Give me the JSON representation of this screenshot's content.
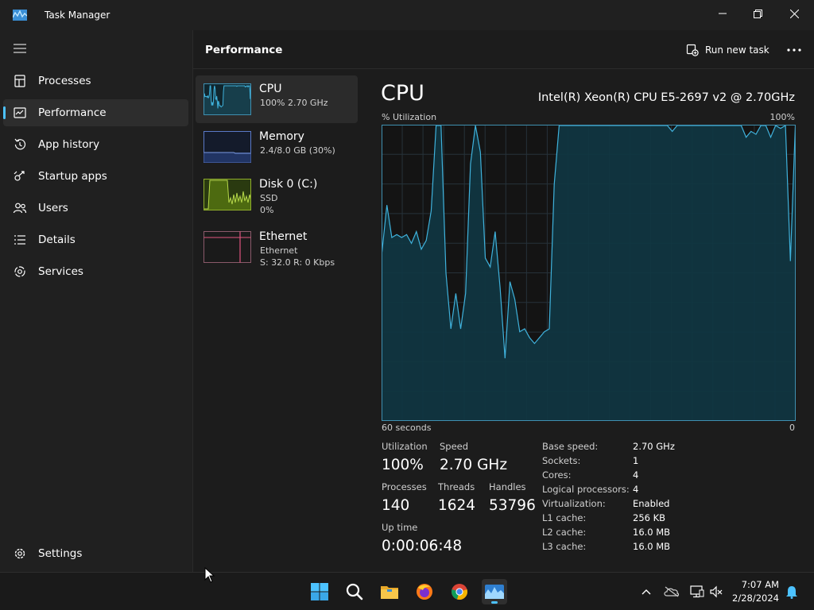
{
  "window": {
    "title": "Task Manager"
  },
  "nav": {
    "items": [
      {
        "label": "Processes",
        "icon": "processes-icon"
      },
      {
        "label": "Performance",
        "icon": "performance-icon",
        "active": true
      },
      {
        "label": "App history",
        "icon": "app-history-icon"
      },
      {
        "label": "Startup apps",
        "icon": "startup-apps-icon"
      },
      {
        "label": "Users",
        "icon": "users-icon"
      },
      {
        "label": "Details",
        "icon": "details-icon"
      },
      {
        "label": "Services",
        "icon": "services-icon"
      }
    ],
    "settings_label": "Settings"
  },
  "header": {
    "title": "Performance",
    "run_task_label": "Run new task"
  },
  "devices": [
    {
      "name": "CPU",
      "line1": "100%  2.70 GHz",
      "line2": ""
    },
    {
      "name": "Memory",
      "line1": "2.4/8.0 GB (30%)",
      "line2": ""
    },
    {
      "name": "Disk 0 (C:)",
      "line1": "SSD",
      "line2": "0%"
    },
    {
      "name": "Ethernet",
      "line1": "Ethernet",
      "line2": "S: 32.0  R: 0 Kbps"
    }
  ],
  "cpu": {
    "title": "CPU",
    "model": "Intel(R) Xeon(R) CPU E5-2697 v2 @ 2.70GHz",
    "graph_label": "% Utilization",
    "graph_max_label": "100%",
    "graph_time_label": "60 seconds",
    "graph_min_label": "0",
    "stats": {
      "utilization_label": "Utilization",
      "utilization": "100%",
      "speed_label": "Speed",
      "speed": "2.70 GHz",
      "processes_label": "Processes",
      "processes": "140",
      "threads_label": "Threads",
      "threads": "1624",
      "handles_label": "Handles",
      "handles": "53796",
      "uptime_label": "Up time",
      "uptime": "0:00:06:48"
    },
    "specs": [
      {
        "label": "Base speed:",
        "value": "2.70 GHz"
      },
      {
        "label": "Sockets:",
        "value": "1"
      },
      {
        "label": "Cores:",
        "value": "4"
      },
      {
        "label": "Logical processors:",
        "value": "4"
      },
      {
        "label": "Virtualization:",
        "value": "Enabled"
      },
      {
        "label": "L1 cache:",
        "value": "256 KB"
      },
      {
        "label": "L2 cache:",
        "value": "16.0 MB"
      },
      {
        "label": "L3 cache:",
        "value": "16.0 MB"
      }
    ],
    "history": [
      57,
      73,
      62,
      63,
      62,
      63,
      60,
      64,
      58,
      61,
      71,
      100,
      100,
      50,
      31,
      43,
      31,
      43,
      87,
      100,
      91,
      55,
      52,
      64,
      45,
      21,
      47,
      41,
      30,
      31,
      28,
      26,
      28,
      30,
      31,
      80,
      100,
      100,
      100,
      100,
      100,
      100,
      100,
      100,
      100,
      100,
      100,
      100,
      100,
      100,
      100,
      100,
      100,
      100,
      100,
      100,
      100,
      100,
      100,
      98,
      100,
      100,
      100,
      100,
      100,
      100,
      100,
      100,
      100,
      100,
      100,
      100,
      100,
      100,
      96,
      98,
      97,
      100,
      100,
      96,
      100,
      99,
      100,
      54,
      100
    ]
  },
  "colors": {
    "accent": "#4cc2ff",
    "cpu_line": "#3fb2dc",
    "cpu_fill": "#0f3642",
    "grid": "#26323a"
  },
  "taskbar": {
    "time": "7:07 AM",
    "date": "2/28/2024"
  }
}
